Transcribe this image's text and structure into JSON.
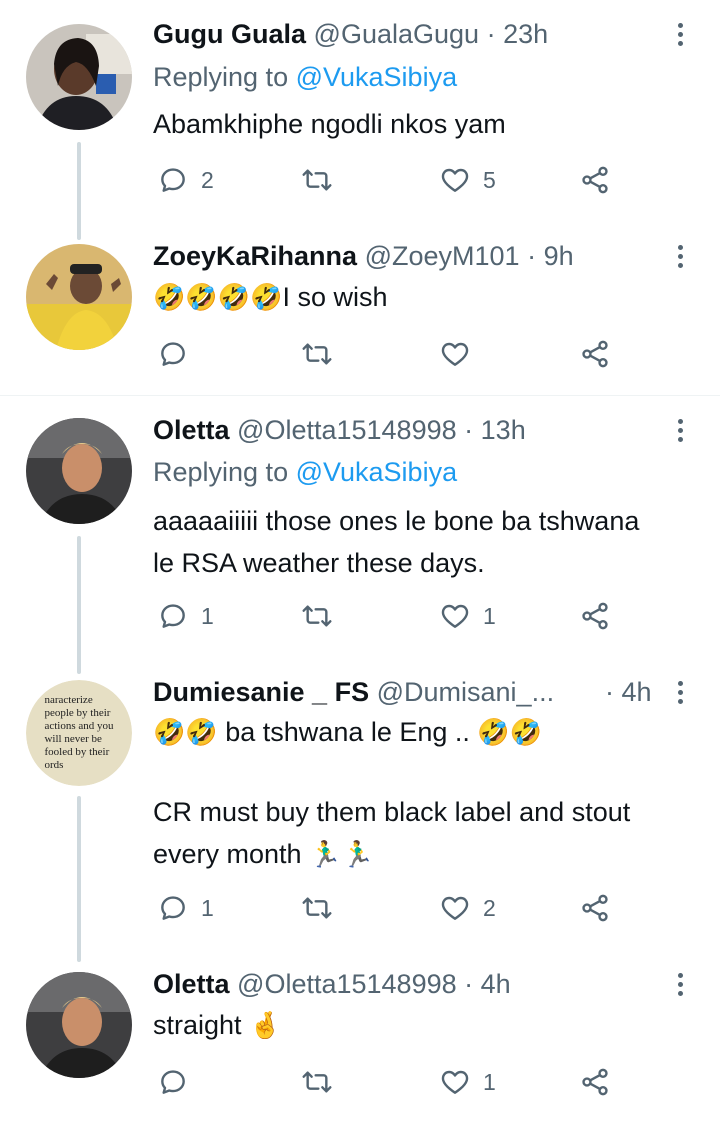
{
  "tweets": [
    {
      "name": "Gugu Guala",
      "handle": "@GualaGugu",
      "dot": "·",
      "time": "23h",
      "replying_prefix": "Replying to ",
      "replying_to": "@VukaSibiya",
      "text": "Abamkhiphe ngodli nkos yam",
      "replies": "2",
      "retweets": "",
      "likes": "5"
    },
    {
      "name": "ZoeyKaRihanna",
      "handle": "@ZoeyM101",
      "dot": "·",
      "time": "9h",
      "text_emoji": "🤣🤣🤣🤣",
      "text": "I so wish",
      "replies": "",
      "retweets": "",
      "likes": ""
    },
    {
      "name": "Oletta",
      "handle": "@Oletta15148998",
      "dot": "·",
      "time": "13h",
      "replying_prefix": "Replying to ",
      "replying_to": "@VukaSibiya",
      "text_line1": "aaaaaiiiii those ones le bone ba tshwana",
      "text_line2": "le RSA weather these days.",
      "replies": "1",
      "retweets": "",
      "likes": "1"
    },
    {
      "name": "Dumiesanie _ FS",
      "handle": "@Dumisani_...",
      "dot": "·",
      "time": "4h",
      "avatar_quote": [
        "naracterize",
        "people by their",
        "actions and you",
        "will never be",
        "fooled by their",
        "ords"
      ],
      "text_line1_emoji_a": "🤣🤣",
      "text_line1": " ba tshwana le Eng .. ",
      "text_line1_emoji_b": "🤣🤣",
      "text_line2": "CR must buy them black label and stout",
      "text_line3": "every month ",
      "text_line3_emoji": "🏃‍♂️🏃‍♂️",
      "replies": "1",
      "retweets": "",
      "likes": "2"
    },
    {
      "name": "Oletta",
      "handle": "@Oletta15148998",
      "dot": "·",
      "time": "4h",
      "text": "straight ",
      "text_emoji": "🤞",
      "replies": "",
      "retweets": "",
      "likes": "1"
    }
  ],
  "icons": {
    "reply": "reply-icon",
    "retweet": "retweet-icon",
    "like": "heart-icon",
    "share": "share-icon",
    "more": "more-options-icon"
  },
  "colors": {
    "link": "#1d9bf0",
    "muted": "#536471",
    "thread_line": "#cfd9de"
  }
}
